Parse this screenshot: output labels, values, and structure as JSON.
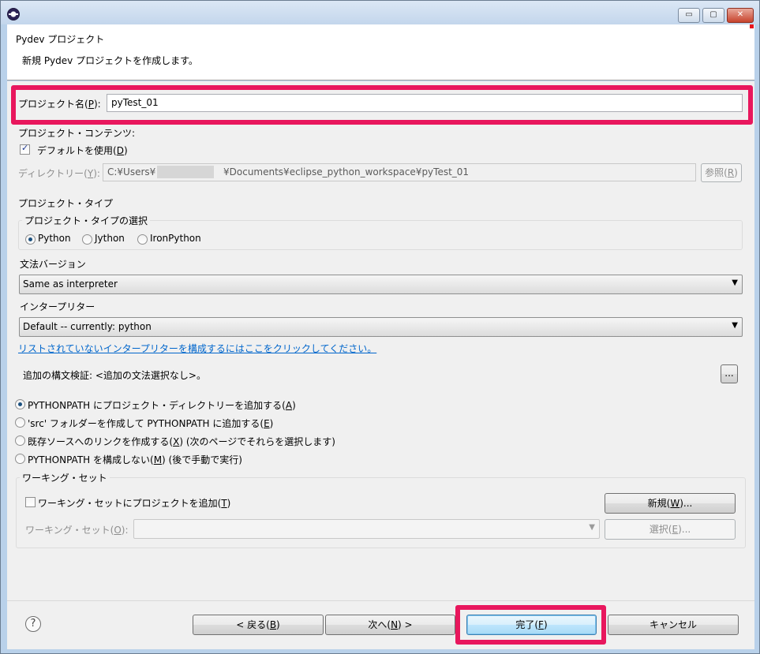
{
  "window": {
    "controls": {
      "minimize": "▭",
      "maximize": "▢",
      "close": "✕"
    }
  },
  "banner": {
    "title": "Pydev プロジェクト",
    "description": "新規 Pydev プロジェクトを作成します。"
  },
  "project_name": {
    "label_prefix": "プロジェクト名(",
    "label_key": "P",
    "label_suffix": "):",
    "value": "pyTest_01"
  },
  "contents": {
    "heading": "プロジェクト・コンテンツ:",
    "use_default_prefix": "デフォルトを使用(",
    "use_default_key": "D",
    "use_default_suffix": ")",
    "use_default_checked": true,
    "directory_label_prefix": "ディレクトリー(",
    "directory_label_key": "Y",
    "directory_label_suffix": "):",
    "directory_value_start": "C:¥Users¥",
    "directory_value_end": "¥Documents¥eclipse_python_workspace¥pyTest_01",
    "browse_prefix": "参照(",
    "browse_key": "R",
    "browse_suffix": ")"
  },
  "project_type": {
    "heading": "プロジェクト・タイプ",
    "group_title": "プロジェクト・タイプの選択",
    "options": [
      "Python",
      "Jython",
      "IronPython"
    ],
    "selected": "Python"
  },
  "grammar": {
    "label": "文法バージョン",
    "value": "Same as interpreter"
  },
  "interpreter": {
    "label": "インタープリター",
    "value": "Default  --  currently: python",
    "config_link": "リストされていないインタープリターを構成するにはここをクリックしてください。"
  },
  "syntax_check": {
    "text": "追加の構文検証: <追加の文法選択なし>。",
    "button": "..."
  },
  "pythonpath": {
    "options": [
      {
        "prefix": "PYTHONPATH にプロジェクト・ディレクトリーを追加する(",
        "key": "A",
        "suffix": ")"
      },
      {
        "prefix": "'src' フォルダーを作成して PYTHONPATH に追加する(",
        "key": "E",
        "suffix": ")"
      },
      {
        "prefix": "既存ソースへのリンクを作成する(",
        "key": "X",
        "suffix": ") (次のページでそれらを選択します)"
      },
      {
        "prefix": "PYTHONPATH を構成しない(",
        "key": "M",
        "suffix": ") (後で手動で実行)"
      }
    ],
    "selected_index": 0
  },
  "working_set": {
    "group_title": "ワーキング・セット",
    "add_prefix": "ワーキング・セットにプロジェクトを追加(",
    "add_key": "T",
    "add_suffix": ")",
    "add_checked": false,
    "new_prefix": "新規(",
    "new_key": "W",
    "new_suffix": ")...",
    "sets_label_prefix": "ワーキング・セット(",
    "sets_label_key": "O",
    "sets_label_suffix": "):",
    "select_prefix": "選択(",
    "select_key": "E",
    "select_suffix": ")..."
  },
  "footer": {
    "help": "?",
    "back_prefix": "< 戻る(",
    "back_key": "B",
    "back_suffix": ")",
    "next_prefix": "次へ(",
    "next_key": "N",
    "next_suffix": ") >",
    "finish_prefix": "完了(",
    "finish_key": "F",
    "finish_suffix": ")",
    "cancel": "キャンセル"
  },
  "colors": {
    "highlight": "#e8175d",
    "link": "#0066cc"
  }
}
